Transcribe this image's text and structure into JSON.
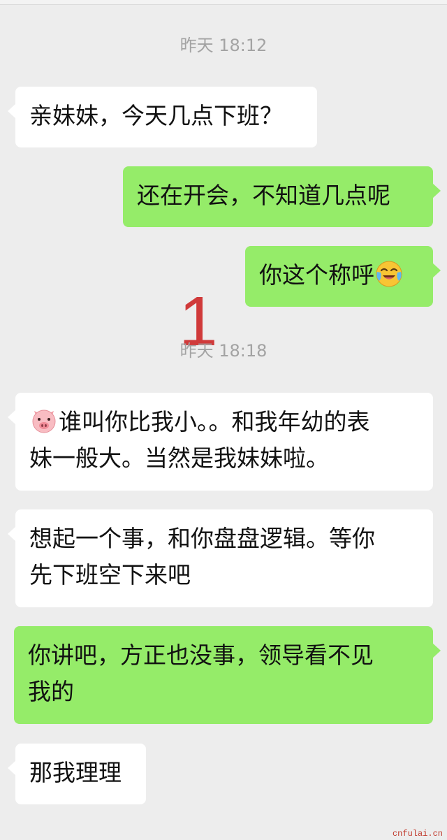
{
  "timestamps": {
    "first": "昨天 18:12",
    "second": "昨天 18:18"
  },
  "messages": [
    {
      "side": "in",
      "text": "亲妹妹，今天几点下班？"
    },
    {
      "side": "out",
      "text": "还在开会，不知道几点呢"
    },
    {
      "side": "out",
      "text": "你这个称呼",
      "emoji": "crying-laughing-emoji-icon"
    },
    {
      "side": "in",
      "emoji": "pig-face-emoji-icon",
      "line1": "谁叫你比我小。。和我年幼的表",
      "line2": "妹一般大。当然是我妹妹啦。"
    },
    {
      "side": "in",
      "line1": "想起一个事，和你盘盘逻辑。等你",
      "line2": "先下班空下来吧"
    },
    {
      "side": "out",
      "line1": "你讲吧，方正也没事，领导看不见",
      "line2": "我的"
    },
    {
      "side": "in",
      "text": "那我理理"
    }
  ],
  "annotation": "1",
  "watermark": "cnfulai.cn",
  "colors": {
    "background": "#ededed",
    "incoming_bubble": "#ffffff",
    "outgoing_bubble": "#95ec69",
    "timestamp_text": "#a3a3a3",
    "annotation": "#d03a3a"
  }
}
